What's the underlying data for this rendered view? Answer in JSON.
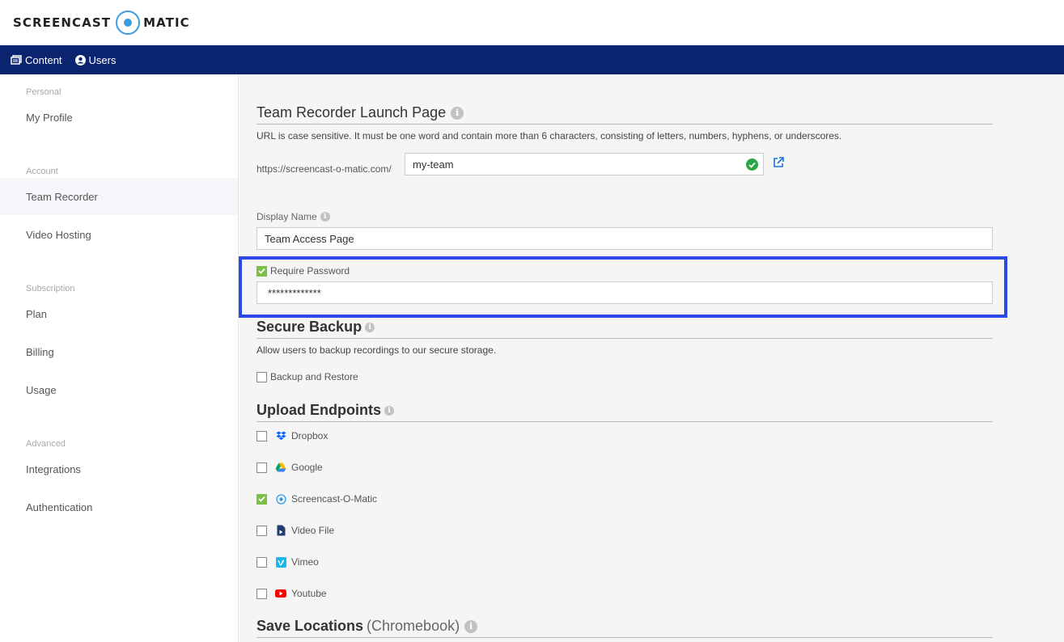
{
  "brand": {
    "left": "SCREENCAST",
    "right": "MATIC"
  },
  "nav": {
    "content": "Content",
    "users": "Users"
  },
  "sidebar": {
    "sections": {
      "personal": "Personal",
      "account": "Account",
      "subscription": "Subscription",
      "advanced": "Advanced"
    },
    "items": {
      "my_profile": "My Profile",
      "team_recorder": "Team Recorder",
      "video_hosting": "Video Hosting",
      "plan": "Plan",
      "billing": "Billing",
      "usage": "Usage",
      "integrations": "Integrations",
      "authentication": "Authentication"
    }
  },
  "launch_page": {
    "title": "Team Recorder Launch Page",
    "description": "URL is case sensitive. It must be one word and contain more than 6 characters, consisting of letters, numbers, hyphens, or underscores.",
    "url_prefix": "https://screencast-o-matic.com/",
    "url_value": "my-team"
  },
  "display_name": {
    "label": "Display Name",
    "value": "Team Access Page"
  },
  "password": {
    "label": "Require Password",
    "checked": true,
    "value": "*************"
  },
  "secure_backup": {
    "title": "Secure Backup",
    "description": "Allow users to backup recordings to our secure storage.",
    "option": "Backup and Restore"
  },
  "upload_endpoints": {
    "title": "Upload Endpoints",
    "items": [
      {
        "label": "Dropbox",
        "icon": "dropbox-icon",
        "checked": false
      },
      {
        "label": "Google",
        "icon": "google-drive-icon",
        "checked": false
      },
      {
        "label": "Screencast-O-Matic",
        "icon": "screencast-icon",
        "checked": true
      },
      {
        "label": "Video File",
        "icon": "video-file-icon",
        "checked": false
      },
      {
        "label": "Vimeo",
        "icon": "vimeo-icon",
        "checked": false
      },
      {
        "label": "Youtube",
        "icon": "youtube-icon",
        "checked": false
      }
    ]
  },
  "save_locations": {
    "title": "Save Locations",
    "suffix": "(Chromebook)"
  },
  "colors": {
    "navbar": "#0a2470",
    "highlight": "#2a49e6",
    "check": "#7ac143",
    "brand": "#3a9be0"
  }
}
